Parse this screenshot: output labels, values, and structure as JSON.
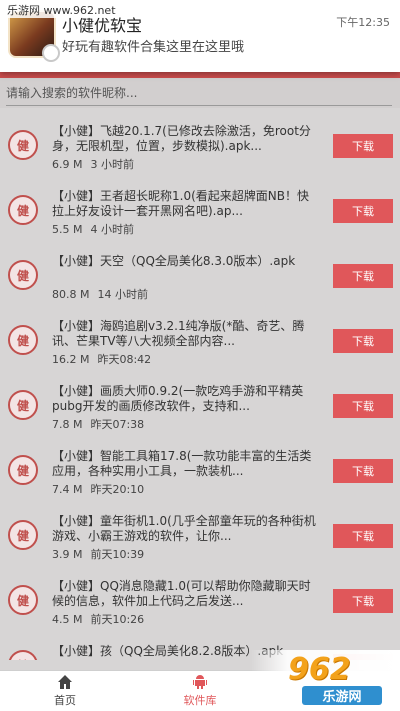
{
  "watermark_top": "乐游网 www.962.net",
  "notification": {
    "app_name": "小健优软宝",
    "message": "好玩有趣软件合集这里在这里哦",
    "time": "下午12:35"
  },
  "search": {
    "placeholder": "请输入搜索的软件昵称..."
  },
  "download_label": "下载",
  "items": [
    {
      "name": "【小健】飞越20.1.7(已修改去除激活，免root分身，无限机型，位置，步数模拟).apk...",
      "size": "6.9 M",
      "time": "3 小时前"
    },
    {
      "name": "【小健】王者超长昵称1.0(看起来超牌面NB！快拉上好友设计一套开黑网名吧).ap...",
      "size": "5.5 M",
      "time": "4 小时前"
    },
    {
      "name": "【小健】天空（QQ全局美化8.3.0版本）.apk",
      "size": "80.8 M",
      "time": "14 小时前"
    },
    {
      "name": "【小健】海鸥追剧v3.2.1纯净版(*酷、奇艺、腾讯、芒果TV等八大视频全部内容...",
      "size": "16.2 M",
      "time": "昨天08:42"
    },
    {
      "name": "【小健】画质大师0.9.2(一款吃鸡手游和平精英pubg开发的画质修改软件，支持和...",
      "size": "7.8 M",
      "time": "昨天07:38"
    },
    {
      "name": "【小健】智能工具箱17.8(一款功能丰富的生活类应用，各种实用小工具，一款装机...",
      "size": "7.4 M",
      "time": "昨天20:10"
    },
    {
      "name": "【小健】童年街机1.0(几乎全部童年玩的各种街机游戏、小霸王游戏的软件，让你...",
      "size": "3.9 M",
      "time": "前天10:39"
    },
    {
      "name": "【小健】QQ消息隐藏1.0(可以帮助你隐藏聊天时候的信息，软件加上代码之后发送...",
      "size": "4.5 M",
      "time": "前天10:26"
    },
    {
      "name": "【小健】孩（QQ全局美化8.2.8版本）.apk",
      "size": "",
      "time": ""
    }
  ],
  "nav": {
    "home": "首页",
    "library": "软件库"
  },
  "brand": {
    "logo_text": "962",
    "tagline": "乐游网"
  },
  "icons": {
    "home": "home-icon",
    "library": "android-icon",
    "item_logo": "小健-logo",
    "item_logo_char": "健"
  },
  "colors": {
    "accent": "#e0575a",
    "header_bar": "#cc4d4d"
  }
}
